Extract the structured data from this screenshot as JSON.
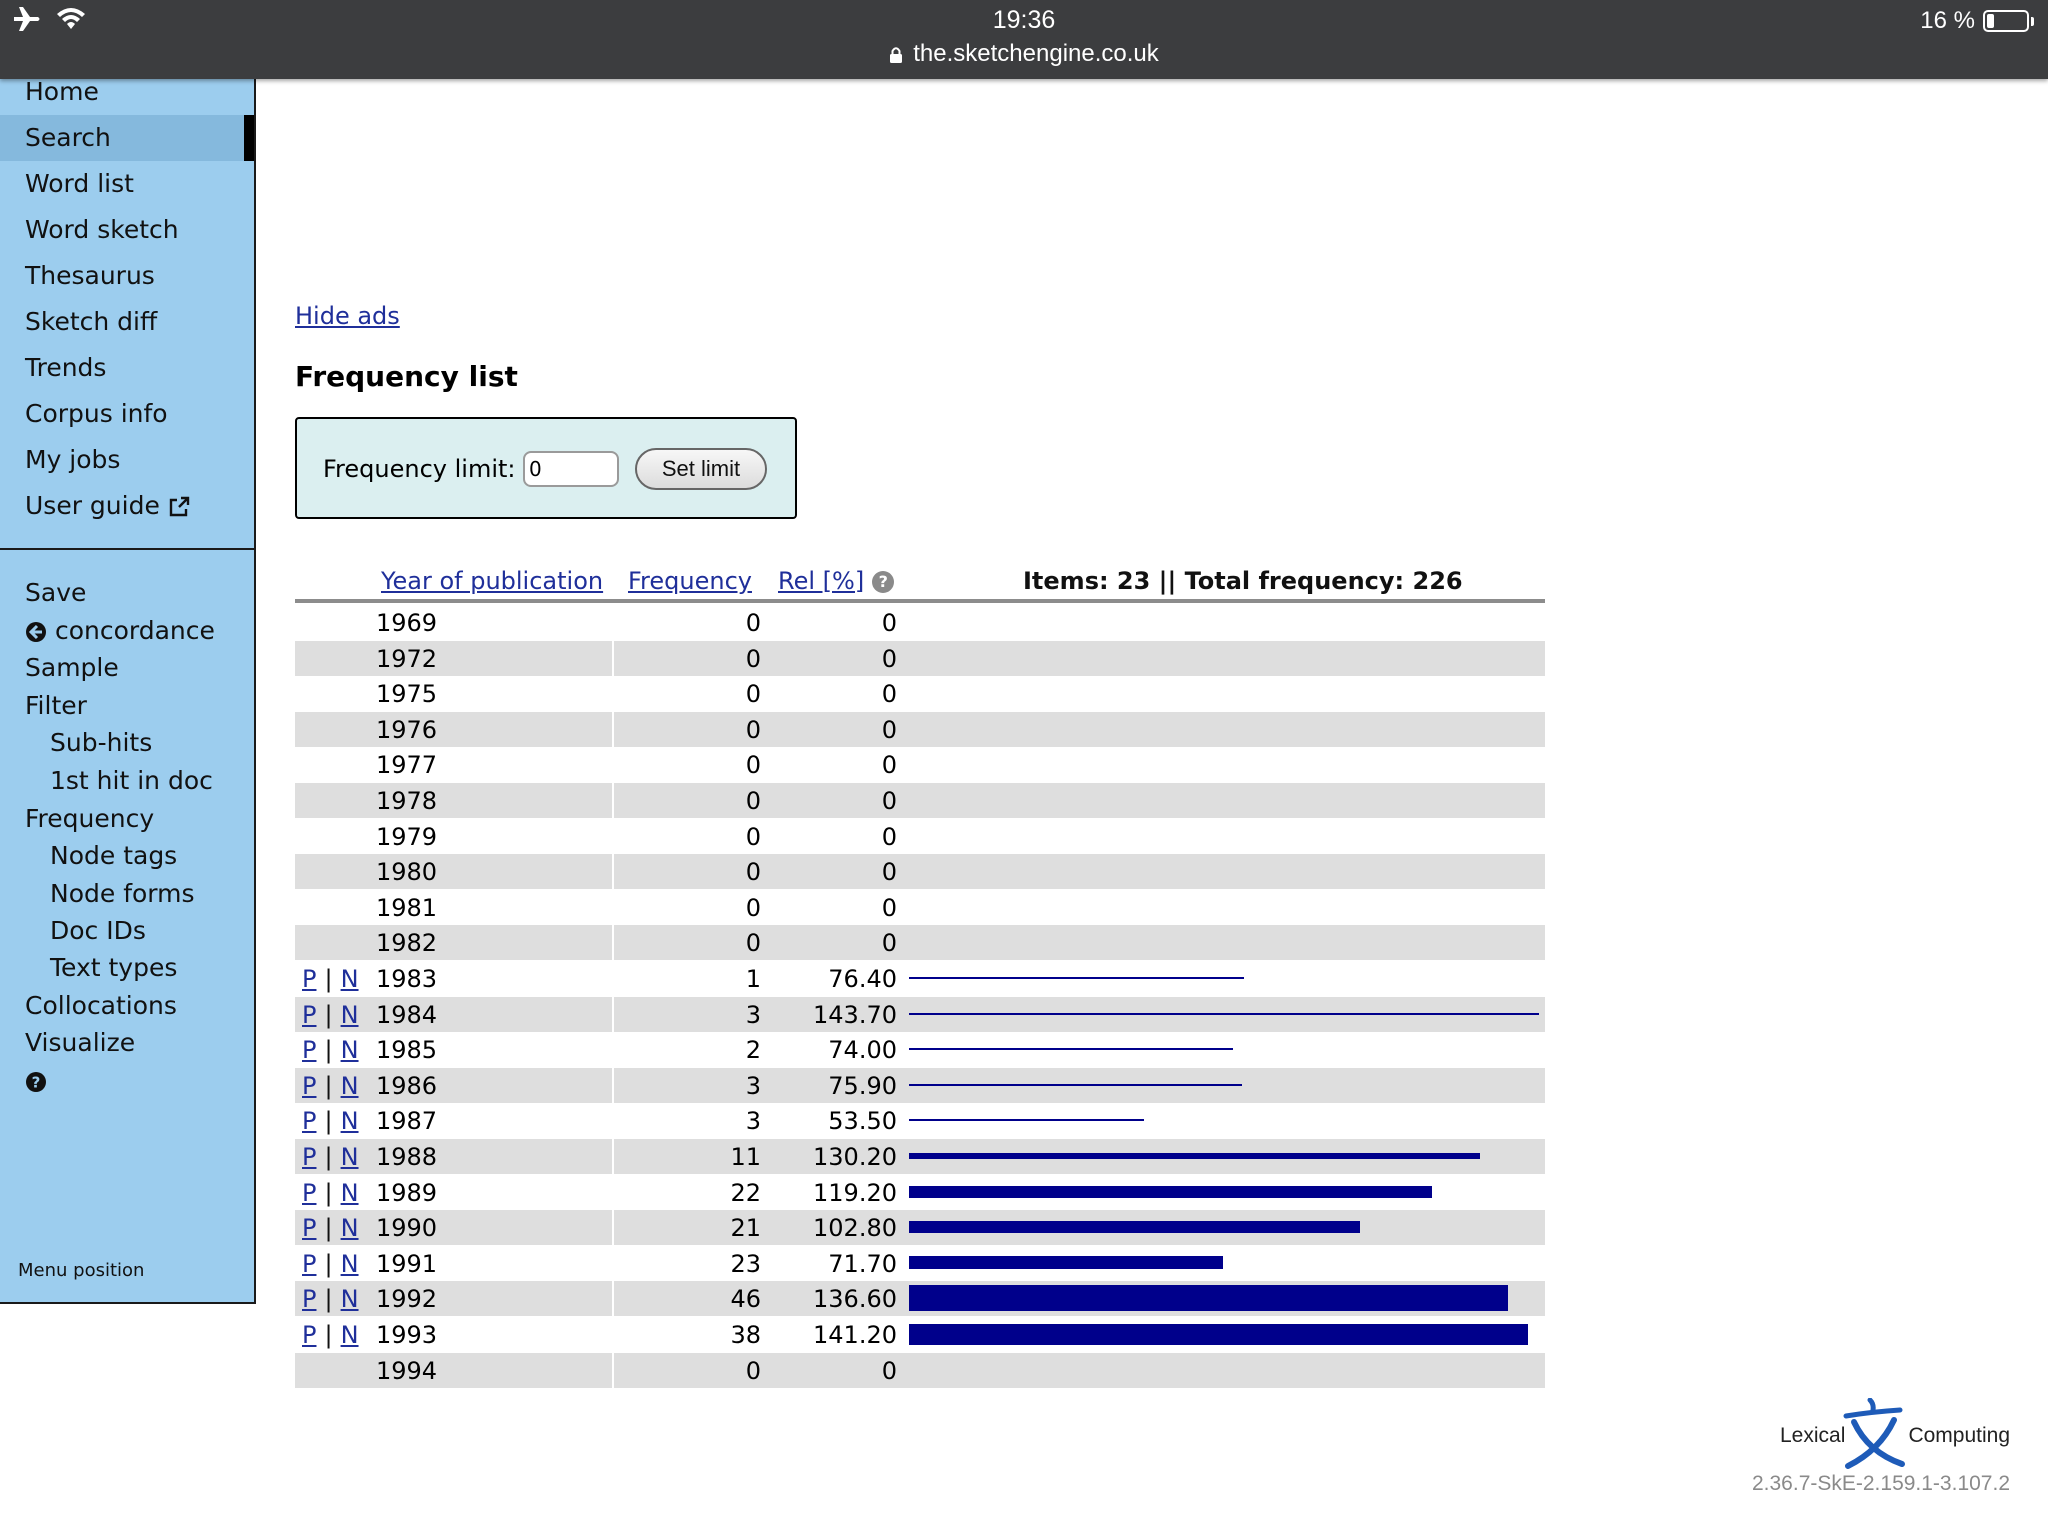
{
  "statusbar": {
    "time": "19:36",
    "url": "the.sketchengine.co.uk",
    "battery_text": "16 %",
    "battery_level": 0.16,
    "icons": [
      "airplane-icon",
      "wifi-icon",
      "lock-icon",
      "battery-icon"
    ]
  },
  "sidebar": {
    "nav": [
      {
        "label": "Home",
        "name": "sidebar-item-home"
      },
      {
        "label": "Search",
        "name": "sidebar-item-search",
        "active": true
      },
      {
        "label": "Word list",
        "name": "sidebar-item-word-list"
      },
      {
        "label": "Word sketch",
        "name": "sidebar-item-word-sketch"
      },
      {
        "label": "Thesaurus",
        "name": "sidebar-item-thesaurus"
      },
      {
        "label": "Sketch diff",
        "name": "sidebar-item-sketch-diff"
      },
      {
        "label": "Trends",
        "name": "sidebar-item-trends"
      },
      {
        "label": "Corpus info",
        "name": "sidebar-item-corpus-info"
      },
      {
        "label": "My jobs",
        "name": "sidebar-item-my-jobs"
      },
      {
        "label": "User guide",
        "name": "sidebar-item-user-guide",
        "icon": "external-link-icon"
      }
    ],
    "actions": {
      "save": "Save",
      "concordance": "concordance",
      "sample": "Sample",
      "filter": "Filter",
      "sub_hits": "Sub-hits",
      "first_hit": "1st hit in doc",
      "frequency": "Frequency",
      "node_tags": "Node tags",
      "node_forms": "Node forms",
      "doc_ids": "Doc IDs",
      "text_types": "Text types",
      "collocations": "Collocations",
      "visualize": "Visualize"
    },
    "menu_position": "Menu position"
  },
  "main": {
    "hide_ads": "Hide ads",
    "title": "Frequency list",
    "limit_label": "Frequency limit:",
    "limit_value": "0",
    "set_limit": "Set limit"
  },
  "table": {
    "headers": {
      "year": "Year of publication",
      "frequency": "Frequency",
      "rel": "Rel [%]",
      "summary": "Items: 23 || Total frequency: 226"
    },
    "pn": {
      "p": "P",
      "sep": "|",
      "n": "N"
    },
    "rows": [
      {
        "year": "1969",
        "freq": "0",
        "rel": "0"
      },
      {
        "year": "1972",
        "freq": "0",
        "rel": "0"
      },
      {
        "year": "1975",
        "freq": "0",
        "rel": "0"
      },
      {
        "year": "1976",
        "freq": "0",
        "rel": "0"
      },
      {
        "year": "1977",
        "freq": "0",
        "rel": "0"
      },
      {
        "year": "1978",
        "freq": "0",
        "rel": "0"
      },
      {
        "year": "1979",
        "freq": "0",
        "rel": "0"
      },
      {
        "year": "1980",
        "freq": "0",
        "rel": "0"
      },
      {
        "year": "1981",
        "freq": "0",
        "rel": "0"
      },
      {
        "year": "1982",
        "freq": "0",
        "rel": "0"
      },
      {
        "year": "1983",
        "freq": "1",
        "rel": "76.40",
        "links": true
      },
      {
        "year": "1984",
        "freq": "3",
        "rel": "143.70",
        "links": true
      },
      {
        "year": "1985",
        "freq": "2",
        "rel": "74.00",
        "links": true
      },
      {
        "year": "1986",
        "freq": "3",
        "rel": "75.90",
        "links": true
      },
      {
        "year": "1987",
        "freq": "3",
        "rel": "53.50",
        "links": true
      },
      {
        "year": "1988",
        "freq": "11",
        "rel": "130.20",
        "links": true
      },
      {
        "year": "1989",
        "freq": "22",
        "rel": "119.20",
        "links": true
      },
      {
        "year": "1990",
        "freq": "21",
        "rel": "102.80",
        "links": true
      },
      {
        "year": "1991",
        "freq": "23",
        "rel": "71.70",
        "links": true
      },
      {
        "year": "1992",
        "freq": "46",
        "rel": "136.60",
        "links": true
      },
      {
        "year": "1993",
        "freq": "38",
        "rel": "141.20",
        "links": true
      },
      {
        "year": "1994",
        "freq": "0",
        "rel": "0"
      }
    ]
  },
  "footer": {
    "logo_left": "Lexical",
    "logo_right": "Computing",
    "version": "2.36.7-SkE-2.159.1-3.107.2"
  },
  "colors": {
    "sidebar_bg": "#9ccdee",
    "sidebar_active": "#85b9dd",
    "link": "#1f2f9a",
    "bar": "#00008b",
    "row_alt": "#dedede",
    "limit_box_bg": "#dbeff0"
  }
}
